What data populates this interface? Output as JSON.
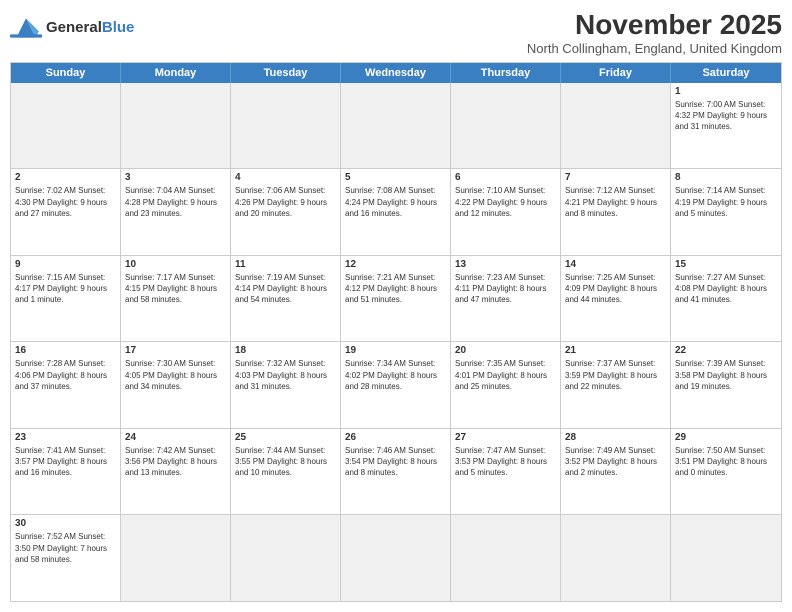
{
  "logo": {
    "text_general": "General",
    "text_blue": "Blue"
  },
  "header": {
    "month": "November 2025",
    "location": "North Collingham, England, United Kingdom"
  },
  "day_headers": [
    "Sunday",
    "Monday",
    "Tuesday",
    "Wednesday",
    "Thursday",
    "Friday",
    "Saturday"
  ],
  "weeks": [
    [
      {
        "num": "",
        "info": "",
        "empty": true
      },
      {
        "num": "",
        "info": "",
        "empty": true
      },
      {
        "num": "",
        "info": "",
        "empty": true
      },
      {
        "num": "",
        "info": "",
        "empty": true
      },
      {
        "num": "",
        "info": "",
        "empty": true
      },
      {
        "num": "",
        "info": "",
        "empty": true
      },
      {
        "num": "1",
        "info": "Sunrise: 7:00 AM\nSunset: 4:32 PM\nDaylight: 9 hours\nand 31 minutes.",
        "empty": false
      }
    ],
    [
      {
        "num": "2",
        "info": "Sunrise: 7:02 AM\nSunset: 4:30 PM\nDaylight: 9 hours\nand 27 minutes.",
        "empty": false
      },
      {
        "num": "3",
        "info": "Sunrise: 7:04 AM\nSunset: 4:28 PM\nDaylight: 9 hours\nand 23 minutes.",
        "empty": false
      },
      {
        "num": "4",
        "info": "Sunrise: 7:06 AM\nSunset: 4:26 PM\nDaylight: 9 hours\nand 20 minutes.",
        "empty": false
      },
      {
        "num": "5",
        "info": "Sunrise: 7:08 AM\nSunset: 4:24 PM\nDaylight: 9 hours\nand 16 minutes.",
        "empty": false
      },
      {
        "num": "6",
        "info": "Sunrise: 7:10 AM\nSunset: 4:22 PM\nDaylight: 9 hours\nand 12 minutes.",
        "empty": false
      },
      {
        "num": "7",
        "info": "Sunrise: 7:12 AM\nSunset: 4:21 PM\nDaylight: 9 hours\nand 8 minutes.",
        "empty": false
      },
      {
        "num": "8",
        "info": "Sunrise: 7:14 AM\nSunset: 4:19 PM\nDaylight: 9 hours\nand 5 minutes.",
        "empty": false
      }
    ],
    [
      {
        "num": "9",
        "info": "Sunrise: 7:15 AM\nSunset: 4:17 PM\nDaylight: 9 hours\nand 1 minute.",
        "empty": false
      },
      {
        "num": "10",
        "info": "Sunrise: 7:17 AM\nSunset: 4:15 PM\nDaylight: 8 hours\nand 58 minutes.",
        "empty": false
      },
      {
        "num": "11",
        "info": "Sunrise: 7:19 AM\nSunset: 4:14 PM\nDaylight: 8 hours\nand 54 minutes.",
        "empty": false
      },
      {
        "num": "12",
        "info": "Sunrise: 7:21 AM\nSunset: 4:12 PM\nDaylight: 8 hours\nand 51 minutes.",
        "empty": false
      },
      {
        "num": "13",
        "info": "Sunrise: 7:23 AM\nSunset: 4:11 PM\nDaylight: 8 hours\nand 47 minutes.",
        "empty": false
      },
      {
        "num": "14",
        "info": "Sunrise: 7:25 AM\nSunset: 4:09 PM\nDaylight: 8 hours\nand 44 minutes.",
        "empty": false
      },
      {
        "num": "15",
        "info": "Sunrise: 7:27 AM\nSunset: 4:08 PM\nDaylight: 8 hours\nand 41 minutes.",
        "empty": false
      }
    ],
    [
      {
        "num": "16",
        "info": "Sunrise: 7:28 AM\nSunset: 4:06 PM\nDaylight: 8 hours\nand 37 minutes.",
        "empty": false
      },
      {
        "num": "17",
        "info": "Sunrise: 7:30 AM\nSunset: 4:05 PM\nDaylight: 8 hours\nand 34 minutes.",
        "empty": false
      },
      {
        "num": "18",
        "info": "Sunrise: 7:32 AM\nSunset: 4:03 PM\nDaylight: 8 hours\nand 31 minutes.",
        "empty": false
      },
      {
        "num": "19",
        "info": "Sunrise: 7:34 AM\nSunset: 4:02 PM\nDaylight: 8 hours\nand 28 minutes.",
        "empty": false
      },
      {
        "num": "20",
        "info": "Sunrise: 7:35 AM\nSunset: 4:01 PM\nDaylight: 8 hours\nand 25 minutes.",
        "empty": false
      },
      {
        "num": "21",
        "info": "Sunrise: 7:37 AM\nSunset: 3:59 PM\nDaylight: 8 hours\nand 22 minutes.",
        "empty": false
      },
      {
        "num": "22",
        "info": "Sunrise: 7:39 AM\nSunset: 3:58 PM\nDaylight: 8 hours\nand 19 minutes.",
        "empty": false
      }
    ],
    [
      {
        "num": "23",
        "info": "Sunrise: 7:41 AM\nSunset: 3:57 PM\nDaylight: 8 hours\nand 16 minutes.",
        "empty": false
      },
      {
        "num": "24",
        "info": "Sunrise: 7:42 AM\nSunset: 3:56 PM\nDaylight: 8 hours\nand 13 minutes.",
        "empty": false
      },
      {
        "num": "25",
        "info": "Sunrise: 7:44 AM\nSunset: 3:55 PM\nDaylight: 8 hours\nand 10 minutes.",
        "empty": false
      },
      {
        "num": "26",
        "info": "Sunrise: 7:46 AM\nSunset: 3:54 PM\nDaylight: 8 hours\nand 8 minutes.",
        "empty": false
      },
      {
        "num": "27",
        "info": "Sunrise: 7:47 AM\nSunset: 3:53 PM\nDaylight: 8 hours\nand 5 minutes.",
        "empty": false
      },
      {
        "num": "28",
        "info": "Sunrise: 7:49 AM\nSunset: 3:52 PM\nDaylight: 8 hours\nand 2 minutes.",
        "empty": false
      },
      {
        "num": "29",
        "info": "Sunrise: 7:50 AM\nSunset: 3:51 PM\nDaylight: 8 hours\nand 0 minutes.",
        "empty": false
      }
    ],
    [
      {
        "num": "30",
        "info": "Sunrise: 7:52 AM\nSunset: 3:50 PM\nDaylight: 7 hours\nand 58 minutes.",
        "empty": false
      },
      {
        "num": "",
        "info": "",
        "empty": true
      },
      {
        "num": "",
        "info": "",
        "empty": true
      },
      {
        "num": "",
        "info": "",
        "empty": true
      },
      {
        "num": "",
        "info": "",
        "empty": true
      },
      {
        "num": "",
        "info": "",
        "empty": true
      },
      {
        "num": "",
        "info": "",
        "empty": true
      }
    ]
  ]
}
